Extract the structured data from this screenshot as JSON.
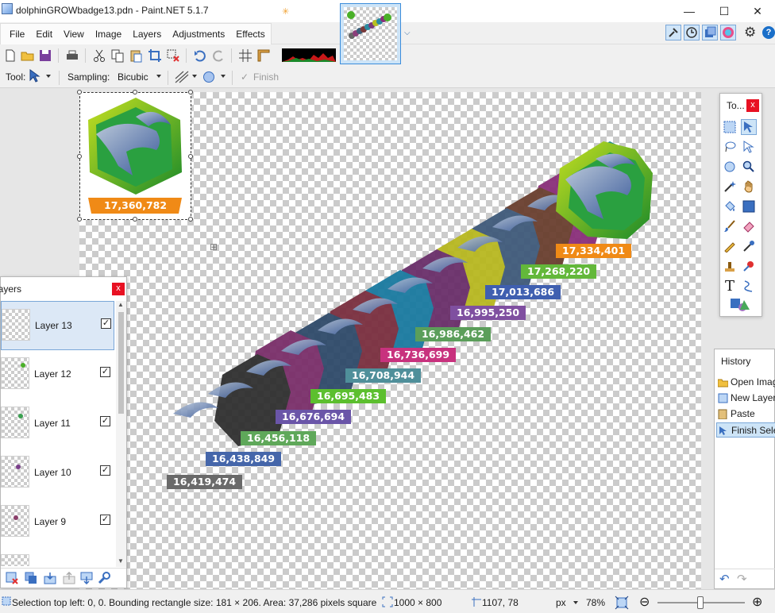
{
  "window": {
    "title": "dolphinGROWbadge13.pdn - Paint.NET 5.1.7"
  },
  "menu": {
    "items": [
      "File",
      "Edit",
      "View",
      "Image",
      "Layers",
      "Adjustments",
      "Effects"
    ]
  },
  "toolbar": {
    "tool_label": "Tool:",
    "sampling_label": "Sampling:",
    "sampling_value": "Bicubic",
    "finish_label": "Finish"
  },
  "tools_window": {
    "title": "To..."
  },
  "history": {
    "title": "History",
    "items": [
      "Open Image",
      "New Layer",
      "Paste",
      "Finish Selection"
    ]
  },
  "layers": {
    "title": "Layers",
    "items": [
      {
        "name": "Layer 13",
        "checked": true
      },
      {
        "name": "Layer 12",
        "checked": true
      },
      {
        "name": "Layer 11",
        "checked": true
      },
      {
        "name": "Layer 10",
        "checked": true
      },
      {
        "name": "Layer 9",
        "checked": true
      }
    ]
  },
  "canvas": {
    "selected_badge_value": "17,360,782",
    "badges": [
      {
        "label": "17,334,401",
        "color": "#f08a16"
      },
      {
        "label": "17,268,220",
        "color": "#63b83a"
      },
      {
        "label": "17,013,686",
        "color": "#3f5fb0"
      },
      {
        "label": "16,995,250",
        "color": "#7f4fa0"
      },
      {
        "label": "16,986,462",
        "color": "#5b9e5a"
      },
      {
        "label": "16,736,699",
        "color": "#c8327e"
      },
      {
        "label": "16,708,944",
        "color": "#4f8f9a"
      },
      {
        "label": "16,695,483",
        "color": "#5cbf2e"
      },
      {
        "label": "16,676,694",
        "color": "#6a55a8"
      },
      {
        "label": "16,456,118",
        "color": "#5fa85a"
      },
      {
        "label": "16,438,849",
        "color": "#4566aa"
      },
      {
        "label": "16,419,474",
        "color": "#6a6a6a"
      }
    ]
  },
  "status": {
    "selection_info": "Selection top left: 0, 0. Bounding rectangle size: 181 × 206. Area: 37,286 pixels square",
    "image_size": "1000 × 800",
    "cursor_pos": "1107, 78",
    "units": "px",
    "zoom": "78%"
  }
}
